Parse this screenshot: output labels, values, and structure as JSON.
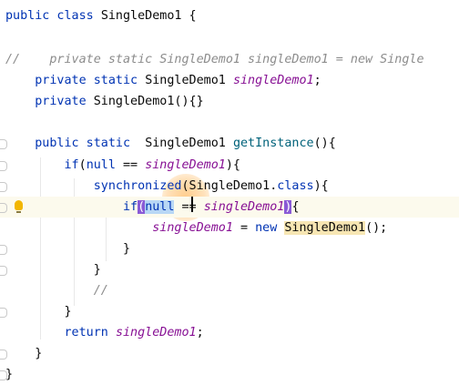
{
  "editor": {
    "lines": [
      {
        "id": "l1",
        "segs": [
          {
            "t": "public class ",
            "c": "kw"
          },
          {
            "t": "SingleDemo1 {",
            "c": "plain"
          }
        ]
      },
      {
        "id": "l2",
        "segs": []
      },
      {
        "id": "l3",
        "segs": [
          {
            "t": "//    private static SingleDemo1 singleDemo1 = new Single",
            "c": "comment"
          }
        ]
      },
      {
        "id": "l4",
        "segs": [
          {
            "t": "    private static ",
            "c": "kw"
          },
          {
            "t": "SingleDemo1 ",
            "c": "plain"
          },
          {
            "t": "singleDemo1",
            "c": "field"
          },
          {
            "t": ";",
            "c": "plain"
          }
        ]
      },
      {
        "id": "l5",
        "segs": [
          {
            "t": "    private ",
            "c": "kw"
          },
          {
            "t": "SingleDemo1(){}",
            "c": "plain"
          }
        ]
      },
      {
        "id": "l6",
        "segs": []
      },
      {
        "id": "l7",
        "segs": [
          {
            "t": "    public static  ",
            "c": "kw"
          },
          {
            "t": "SingleDemo1 ",
            "c": "plain"
          },
          {
            "t": "getInstance",
            "c": "method"
          },
          {
            "t": "(){",
            "c": "plain"
          }
        ]
      },
      {
        "id": "l8",
        "segs": [
          {
            "t": "        if",
            "c": "kw"
          },
          {
            "t": "(",
            "c": "plain"
          },
          {
            "t": "null",
            "c": "kw"
          },
          {
            "t": " == ",
            "c": "plain"
          },
          {
            "t": "singleDemo1",
            "c": "field"
          },
          {
            "t": "){",
            "c": "plain"
          }
        ]
      },
      {
        "id": "l9",
        "segs": [
          {
            "t": "            synchronized",
            "c": "kw"
          },
          {
            "t": "(SingleDemo1.",
            "c": "plain"
          },
          {
            "t": "class",
            "c": "kw"
          },
          {
            "t": "){",
            "c": "plain"
          }
        ]
      },
      {
        "id": "l10",
        "highlight": true,
        "segs": [
          {
            "t": "                if",
            "c": "kw"
          },
          {
            "t": "(",
            "c": "plain brace-match"
          },
          {
            "t": "null",
            "c": "kw sel-word"
          },
          {
            "t": " == ",
            "c": "plain"
          },
          {
            "t": "singleDemo1",
            "c": "field"
          },
          {
            "t": ")",
            "c": "plain brace-match"
          },
          {
            "t": "{",
            "c": "plain"
          }
        ]
      },
      {
        "id": "l11",
        "segs": [
          {
            "t": "                    ",
            "c": "plain"
          },
          {
            "t": "singleDemo1",
            "c": "field"
          },
          {
            "t": " = ",
            "c": "plain"
          },
          {
            "t": "new ",
            "c": "kw"
          },
          {
            "t": "SingleDemo1",
            "c": "plain search-hl"
          },
          {
            "t": "();",
            "c": "plain"
          }
        ]
      },
      {
        "id": "l12",
        "segs": [
          {
            "t": "                }",
            "c": "plain"
          }
        ]
      },
      {
        "id": "l13",
        "segs": [
          {
            "t": "            }",
            "c": "plain"
          }
        ]
      },
      {
        "id": "l14",
        "segs": [
          {
            "t": "            //",
            "c": "comment"
          }
        ]
      },
      {
        "id": "l15",
        "segs": [
          {
            "t": "        }",
            "c": "plain"
          }
        ]
      },
      {
        "id": "l16",
        "segs": [
          {
            "t": "        return ",
            "c": "kw"
          },
          {
            "t": "singleDemo1",
            "c": "field"
          },
          {
            "t": ";",
            "c": "plain"
          }
        ]
      },
      {
        "id": "l17",
        "segs": [
          {
            "t": "    }",
            "c": "plain"
          }
        ]
      },
      {
        "id": "l18",
        "segs": [
          {
            "t": "}",
            "c": "plain"
          }
        ]
      }
    ]
  },
  "icons": {
    "intention_bulb": "lightbulb-icon",
    "fold_marker": "fold-marker-icon"
  },
  "colors": {
    "keyword": "#0033b3",
    "field": "#871094",
    "method": "#00627a",
    "comment": "#8c8c8c",
    "brace_match": "#8a5bd6",
    "current_line": "#fcfaed"
  }
}
